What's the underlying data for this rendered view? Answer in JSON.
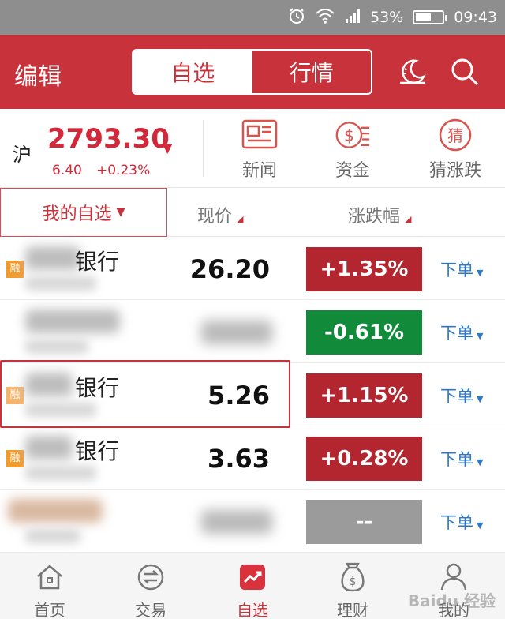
{
  "status_bar": {
    "battery": "53%",
    "time": "09:43"
  },
  "header": {
    "edit_label": "编辑",
    "tabs": [
      {
        "label": "自选",
        "active": true
      },
      {
        "label": "行情",
        "active": false
      }
    ],
    "icons": [
      "night-mode-icon",
      "search-icon"
    ]
  },
  "index": {
    "market": "沪",
    "value": "2793.30",
    "trend_icon": "▼",
    "change": "6.40",
    "change_pct": "+0.23%",
    "tools": [
      {
        "label": "新闻",
        "icon": "news-icon"
      },
      {
        "label": "资金",
        "icon": "funds-icon"
      },
      {
        "label": "猜涨跌",
        "icon": "guess-icon",
        "icon_text": "猜"
      }
    ]
  },
  "columns": {
    "my_list": "我的自选",
    "my_list_arrow": "▼",
    "price": "现价",
    "change": "涨跌幅"
  },
  "rows": [
    {
      "margin_badge": "融",
      "name": "银行",
      "price": "26.20",
      "change": "+1.35%",
      "trend": "up",
      "action": "下单"
    },
    {
      "margin_badge": "",
      "name": "",
      "price": "",
      "change": "-0.61%",
      "trend": "down",
      "action": "下单"
    },
    {
      "margin_badge": "融",
      "name": "银行",
      "price": "5.26",
      "change": "+1.15%",
      "trend": "up",
      "action": "下单"
    },
    {
      "margin_badge": "融",
      "name": "银行",
      "price": "3.63",
      "change": "+0.28%",
      "trend": "up",
      "action": "下单"
    },
    {
      "margin_badge": "",
      "name": "",
      "price": "",
      "change": "--",
      "trend": "flat",
      "action": "下单"
    }
  ],
  "bottom_nav": [
    {
      "label": "首页",
      "icon": "home-icon",
      "active": false
    },
    {
      "label": "交易",
      "icon": "trade-icon",
      "active": false
    },
    {
      "label": "自选",
      "icon": "watchlist-icon",
      "active": true
    },
    {
      "label": "理财",
      "icon": "wealth-icon",
      "active": false
    },
    {
      "label": "我的",
      "icon": "profile-icon",
      "active": false
    }
  ],
  "colors": {
    "brand_red": "#c8323a",
    "up_red": "#b3262f",
    "down_green": "#118a3a",
    "flat_gray": "#9b9b9b",
    "link_blue": "#2d79c7"
  }
}
